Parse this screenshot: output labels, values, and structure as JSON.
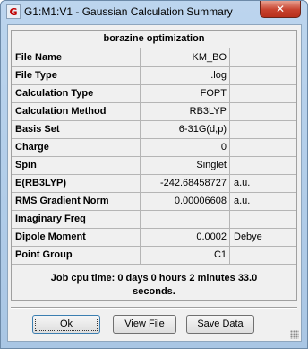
{
  "window": {
    "title": "G1:M1:V1 - Gaussian Calculation Summary",
    "close_glyph": "✕",
    "app_icon_glyph": "G"
  },
  "summary": {
    "title": "borazine optimization",
    "rows": [
      {
        "label": "File Name",
        "value": "KM_BO",
        "unit": ""
      },
      {
        "label": "File Type",
        "value": ".log",
        "unit": ""
      },
      {
        "label": "Calculation Type",
        "value": "FOPT",
        "unit": ""
      },
      {
        "label": "Calculation Method",
        "value": "RB3LYP",
        "unit": ""
      },
      {
        "label": "Basis Set",
        "value": "6-31G(d,p)",
        "unit": ""
      },
      {
        "label": "Charge",
        "value": "0",
        "unit": ""
      },
      {
        "label": "Spin",
        "value": "Singlet",
        "unit": ""
      },
      {
        "label": "E(RB3LYP)",
        "value": "-242.68458727",
        "unit": "a.u."
      },
      {
        "label": "RMS Gradient Norm",
        "value": "0.00006608",
        "unit": "a.u."
      },
      {
        "label": "Imaginary Freq",
        "value": "",
        "unit": ""
      },
      {
        "label": "Dipole Moment",
        "value": "0.0002",
        "unit": "Debye"
      },
      {
        "label": "Point Group",
        "value": "C1",
        "unit": ""
      }
    ],
    "cpu_time_line1": "Job cpu time:  0 days  0 hours  2 minutes 33.0",
    "cpu_time_line2": "seconds."
  },
  "buttons": {
    "ok": "Ok",
    "view_file": "View File",
    "save_data": "Save Data"
  }
}
